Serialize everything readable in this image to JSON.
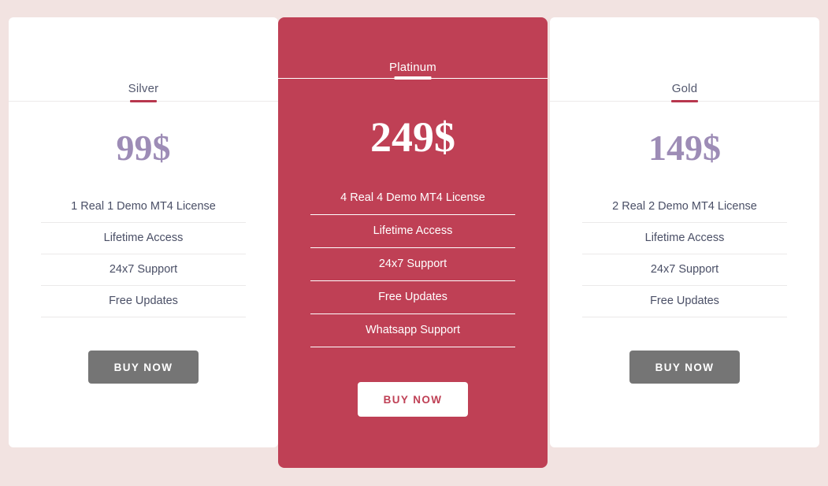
{
  "theme": {
    "page_background": "#f2e3e1",
    "card_background": "#ffffff",
    "featured_background": "#bf4055",
    "price_color": "#9d8cb6",
    "feature_text_color": "#4a4f66",
    "button_background": "#757575",
    "accent_color": "#b8374e"
  },
  "plans": [
    {
      "name": "Silver",
      "price": "99$",
      "features": [
        "1 Real 1 Demo MT4 License",
        "Lifetime Access",
        "24x7 Support",
        "Free Updates"
      ],
      "cta": "BUY NOW"
    },
    {
      "name": "Platinum",
      "price": "249$",
      "features": [
        "4 Real 4 Demo MT4 License",
        "Lifetime Access",
        "24x7 Support",
        "Free Updates",
        "Whatsapp Support"
      ],
      "cta": "BUY NOW"
    },
    {
      "name": "Gold",
      "price": "149$",
      "features": [
        "2 Real 2 Demo MT4 License",
        "Lifetime Access",
        "24x7 Support",
        "Free Updates"
      ],
      "cta": "BUY NOW"
    }
  ]
}
